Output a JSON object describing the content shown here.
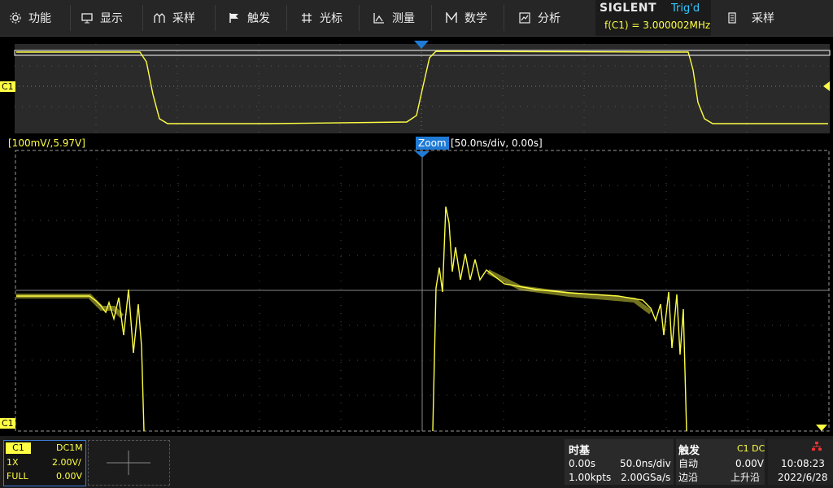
{
  "menu": [
    {
      "label": "功能",
      "icon": "gear-icon"
    },
    {
      "label": "显示",
      "icon": "monitor-icon"
    },
    {
      "label": "采样",
      "icon": "acquire-icon"
    },
    {
      "label": "触发",
      "icon": "flag-icon"
    },
    {
      "label": "光标",
      "icon": "cursor-icon"
    },
    {
      "label": "测量",
      "icon": "measure-icon"
    },
    {
      "label": "数学",
      "icon": "math-icon"
    },
    {
      "label": "分析",
      "icon": "analysis-icon"
    }
  ],
  "brand": "SIGLENT",
  "trigger_status": "Trig'd",
  "frequency": "f(C1) = 3.000002MHz",
  "acquire_button": {
    "label": "采样",
    "icon": "acquire-doc-icon"
  },
  "main": {
    "scale_label": "[100mV/,5.97V]",
    "zoom_tag": "Zoom",
    "zoom_info": "[50.0ns/div, 0.00s]",
    "channel_marker": "C1"
  },
  "channel": {
    "name": "C1",
    "coupling": "DC1M",
    "probe": "1X",
    "vdiv": "2.00V/",
    "bandwidth": "FULL",
    "offset": "0.00V"
  },
  "timebase": {
    "title": "时基",
    "delay": "0.00s",
    "tdiv": "50.0ns/div",
    "points": "1.00kpts",
    "rate": "2.00GSa/s"
  },
  "trigger": {
    "title": "触发",
    "source": "C1 DC",
    "mode": "自动",
    "level": "0.00V",
    "type": "边沿",
    "slope": "上升沿"
  },
  "clock": {
    "time": "10:08:23",
    "date": "2022/6/28"
  },
  "colors": {
    "trace": "#ffff44",
    "accent": "#1f7bd6",
    "trig": "#33c8ff"
  }
}
